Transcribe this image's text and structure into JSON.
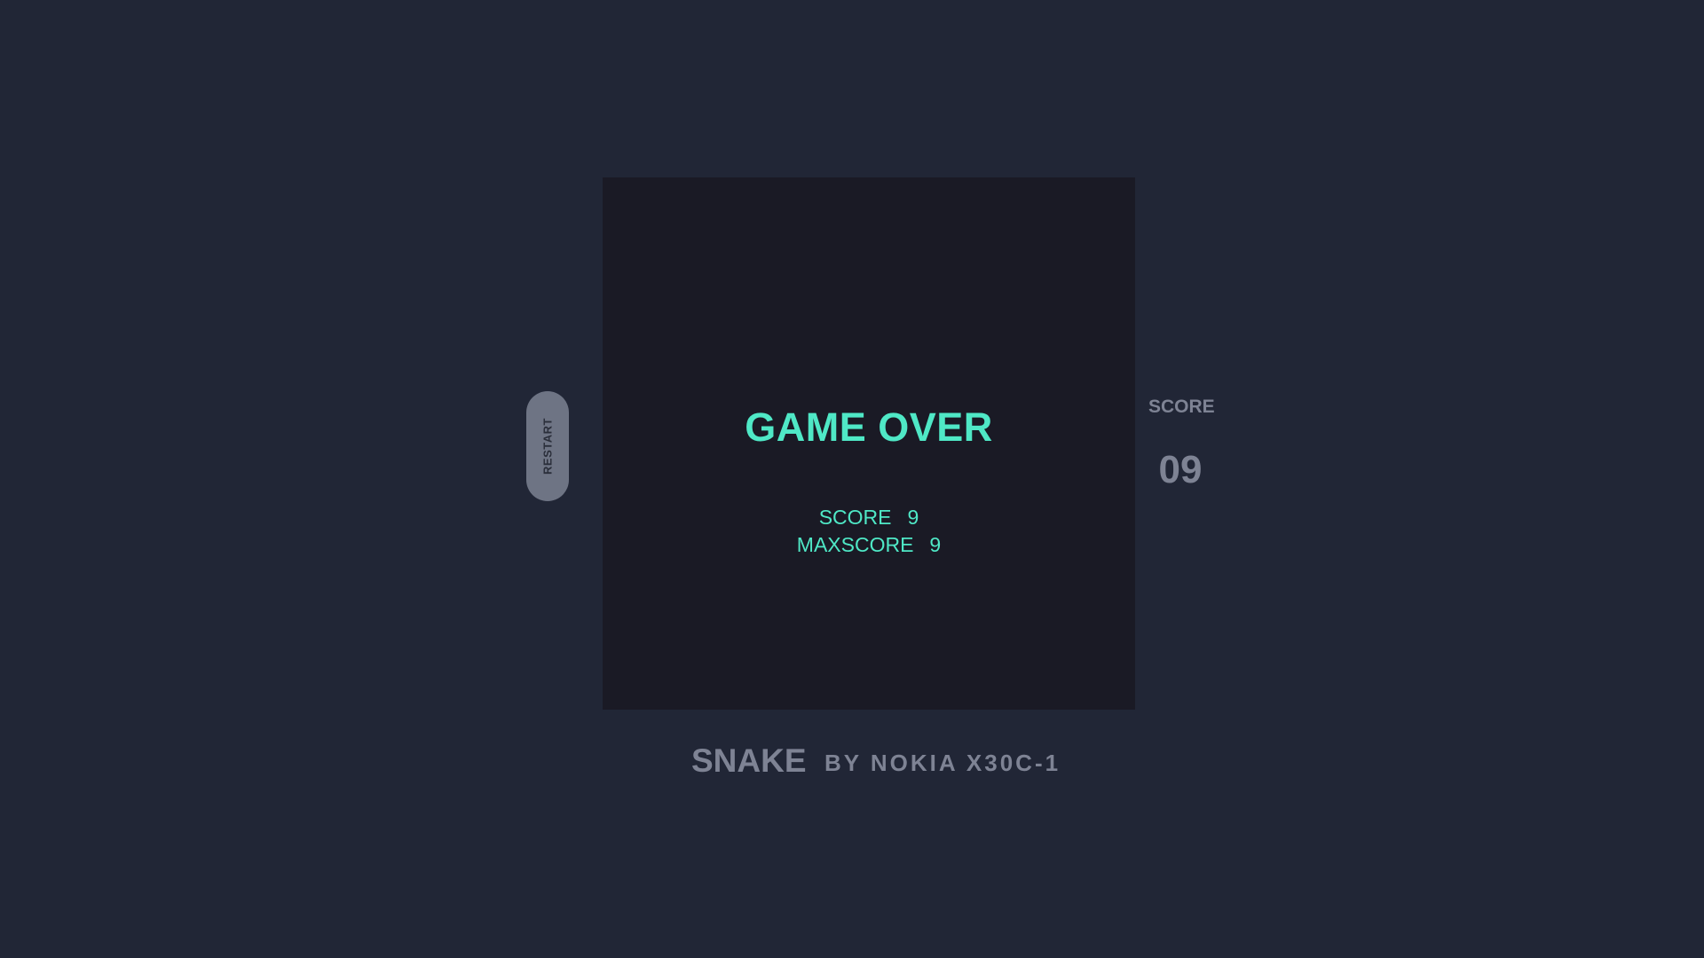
{
  "game": {
    "status_text": "GAME OVER",
    "final_stats": [
      {
        "label": "SCORE",
        "value": "9"
      },
      {
        "label": "MAXSCORE",
        "value": "9"
      }
    ]
  },
  "controls": {
    "restart_label": "RESTART"
  },
  "scoreboard": {
    "label": "SCORE",
    "value": "09"
  },
  "footer": {
    "title": "SNAKE",
    "byline": "BY NOKIA X30C-1"
  },
  "colors": {
    "background": "#212636",
    "board": "#1a1a25",
    "accent": "#4fe8c6",
    "muted_text": "#7e8394",
    "button": "#6e7484"
  }
}
